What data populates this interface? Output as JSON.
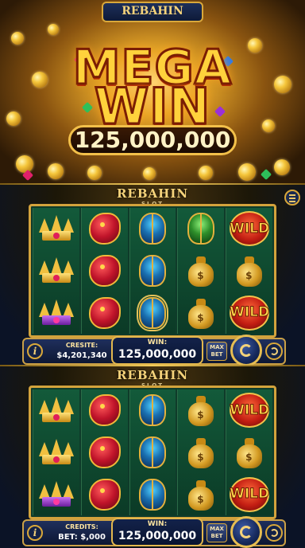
{
  "banner": {
    "logo": "REBAHIN",
    "logo_sub": "SLOT",
    "headline_line1": "MEGA",
    "headline_line2": "WIN",
    "win_amount": "125,000,000"
  },
  "panel_top": {
    "logo": "REBAHIN",
    "logo_sub": "SLOT",
    "reels": [
      [
        "crown",
        "crown",
        "crown-purple"
      ],
      [
        "dragon",
        "dragon",
        "dragon"
      ],
      [
        "scarab-blue",
        "scarab-blue",
        "scarab-blue-framed"
      ],
      [
        "scarab-green",
        "money-bag",
        "money-bag"
      ],
      [
        "wild",
        "money-bag",
        "wild"
      ]
    ],
    "wild_label": "WILD",
    "credits_label": "CRESITE:",
    "credits_value": "$4,201,340",
    "win_label": "WIN:",
    "win_value": "125,000,000",
    "maxbet_line1": "MAX",
    "maxbet_line2": "BET",
    "info_label": "i"
  },
  "panel_bottom": {
    "logo": "REBAHIN",
    "logo_sub": "SLOT",
    "reels": [
      [
        "crown",
        "crown",
        "crown-purple"
      ],
      [
        "dragon",
        "dragon",
        "dragon"
      ],
      [
        "scarab-blue",
        "scarab-blue",
        "scarab-blue"
      ],
      [
        "money-bag",
        "money-bag",
        "money-bag"
      ],
      [
        "wild",
        "money-bag",
        "wild"
      ]
    ],
    "wild_label": "WILD",
    "credits_label": "CREDITS:",
    "credits_value": "BET: $,000",
    "win_label": "WIN:",
    "win_value": "125,000,000",
    "maxbet_line1": "MAX",
    "maxbet_line2": "BET",
    "info_label": "i"
  },
  "colors": {
    "gold": "#f3cc5b",
    "reel_green": "#0f3b2a",
    "bar_blue": "#1f2f5c",
    "wild_red": "#c21d12"
  }
}
